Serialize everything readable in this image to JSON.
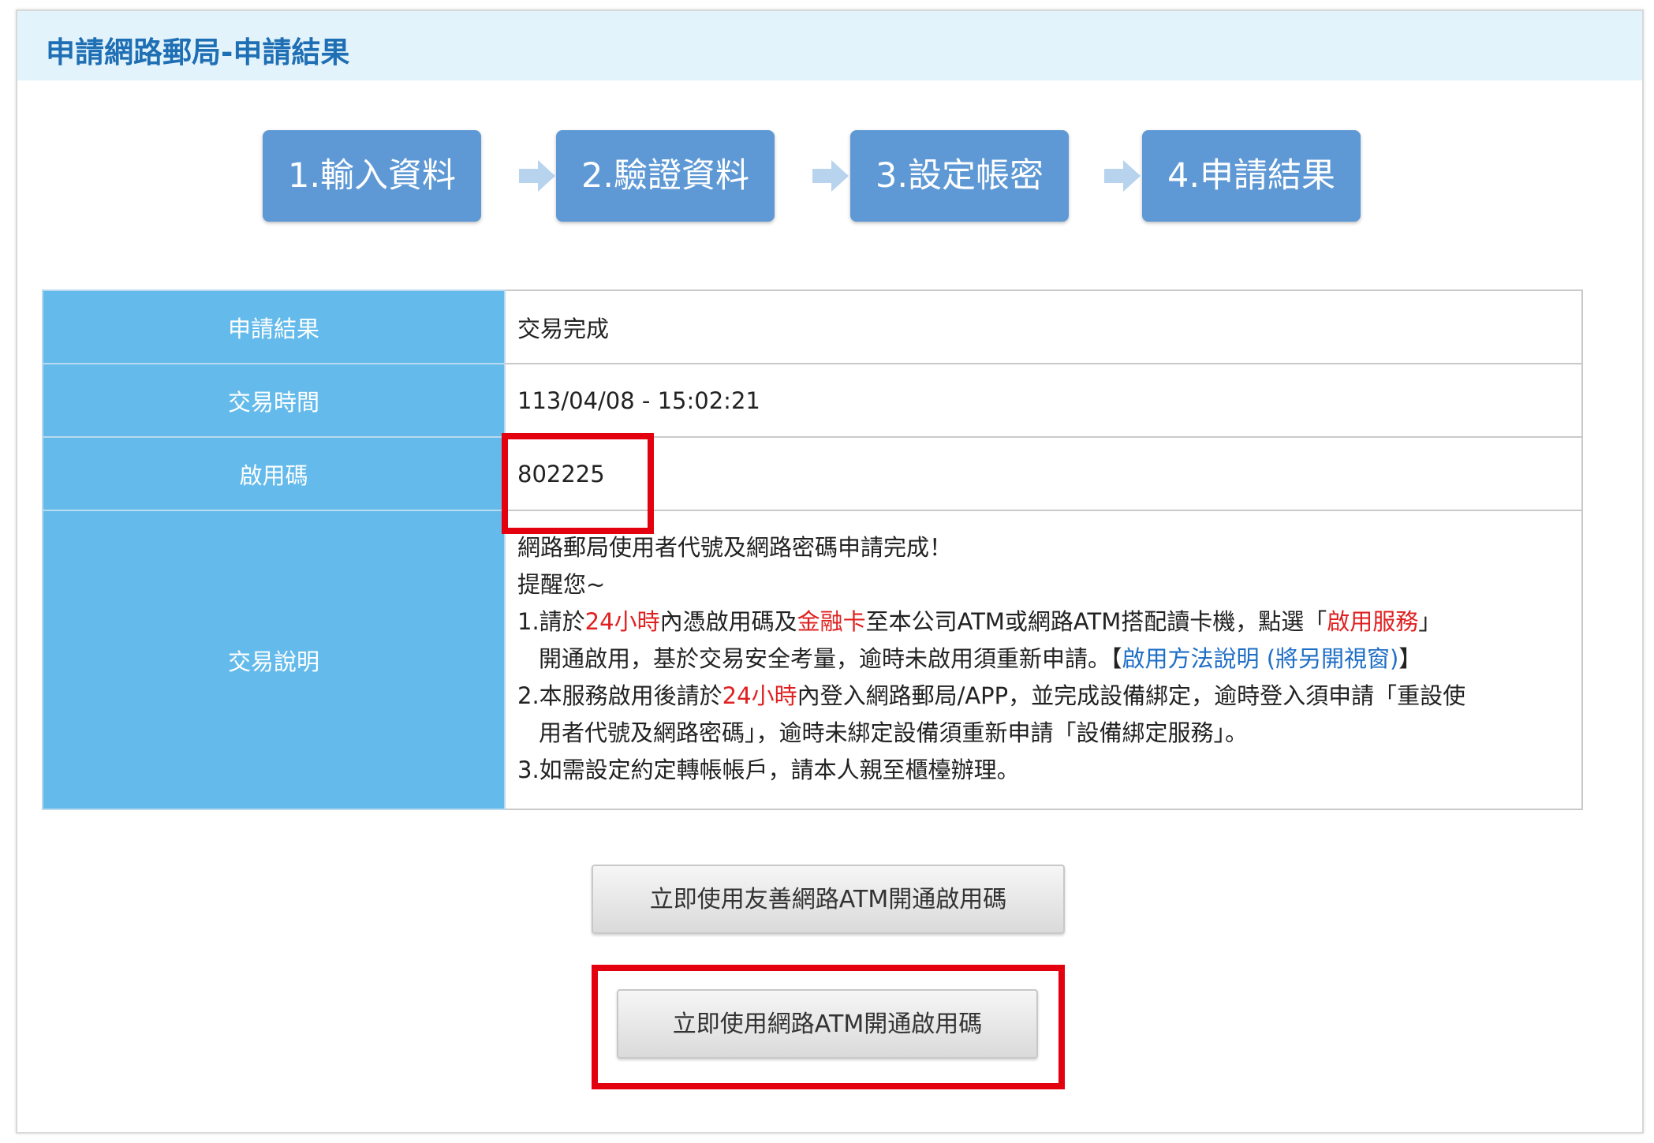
{
  "header": {
    "title": "申請網路郵局-申請結果"
  },
  "steps": [
    {
      "label": "1.輸入資料"
    },
    {
      "label": "2.驗證資料"
    },
    {
      "label": "3.設定帳密"
    },
    {
      "label": "4.申請結果"
    }
  ],
  "table": {
    "rows": [
      {
        "label": "申請結果",
        "value": "交易完成"
      },
      {
        "label": "交易時間",
        "value": "113/04/08 - 15:02:21"
      },
      {
        "label": "啟用碼",
        "value": "802225"
      },
      {
        "label": "交易說明"
      }
    ],
    "description": {
      "line1": "網路郵局使用者代號及網路密碼申請完成！",
      "line2": "提醒您~",
      "item1": {
        "a": "1.請於",
        "b": "24小時",
        "c": "內憑啟用碼及",
        "d": "金融卡",
        "e": "至本公司ATM或網路ATM搭配讀卡機，點選「",
        "f": "啟用服務",
        "g": "」",
        "h": "開通啟用，基於交易安全考量，逾時未啟用須重新申請。【",
        "i": "啟用方法說明 (將另開視窗)",
        "j": "】"
      },
      "item2": {
        "a": "2.本服務啟用後請於",
        "b": "24小時",
        "c": "內登入網路郵局/APP，並完成設備綁定，逾時登入須申請「重設使",
        "d": "用者代號及網路密碼」，逾時未綁定設備須重新申請「設備綁定服務」。"
      },
      "item3": "3.如需設定約定轉帳帳戶，請本人親至櫃檯辦理。"
    }
  },
  "buttons": {
    "friendly_atm": "立即使用友善網路ATM開通啟用碼",
    "web_atm": "立即使用網路ATM開通啟用碼"
  },
  "colors": {
    "header_bg": "#e3f3fc",
    "title": "#1f6fb4",
    "step_bg": "#5e99d5",
    "label_bg": "#64bbeb",
    "highlight": "#e3000f",
    "emphasis_red": "#e02020",
    "link_blue": "#1e6ec6"
  },
  "icons": {
    "step_arrow": "arrow-right-icon"
  }
}
